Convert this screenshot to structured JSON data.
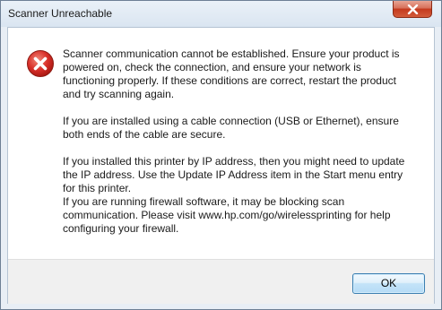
{
  "window": {
    "title": "Scanner Unreachable"
  },
  "icons": {
    "close": "close-icon",
    "error": "error-icon"
  },
  "colors": {
    "error_red": "#d9302a",
    "close_red": "#c4391d"
  },
  "message": {
    "line1": "Scanner communication cannot be established.  Ensure your product is",
    "line2": "powered on, check the connection, and ensure your network is",
    "line3": "functioning properly.  If these conditions are correct, restart the product",
    "line4": "and try scanning again.",
    "line5": "If you are installed using a cable connection (USB or Ethernet), ensure",
    "line6": "both ends of the cable are secure.",
    "line7": "If you installed this printer by IP address, then you might need to update",
    "line8": "the IP address.  Use the Update IP Address item in the Start menu entry",
    "line9": "for this printer.",
    "line10": "If you are running firewall software, it may be blocking scan",
    "line11": "communication.  Please visit www.hp.com/go/wirelessprinting for help",
    "line12": "configuring your firewall."
  },
  "buttons": {
    "ok_label": "OK"
  }
}
